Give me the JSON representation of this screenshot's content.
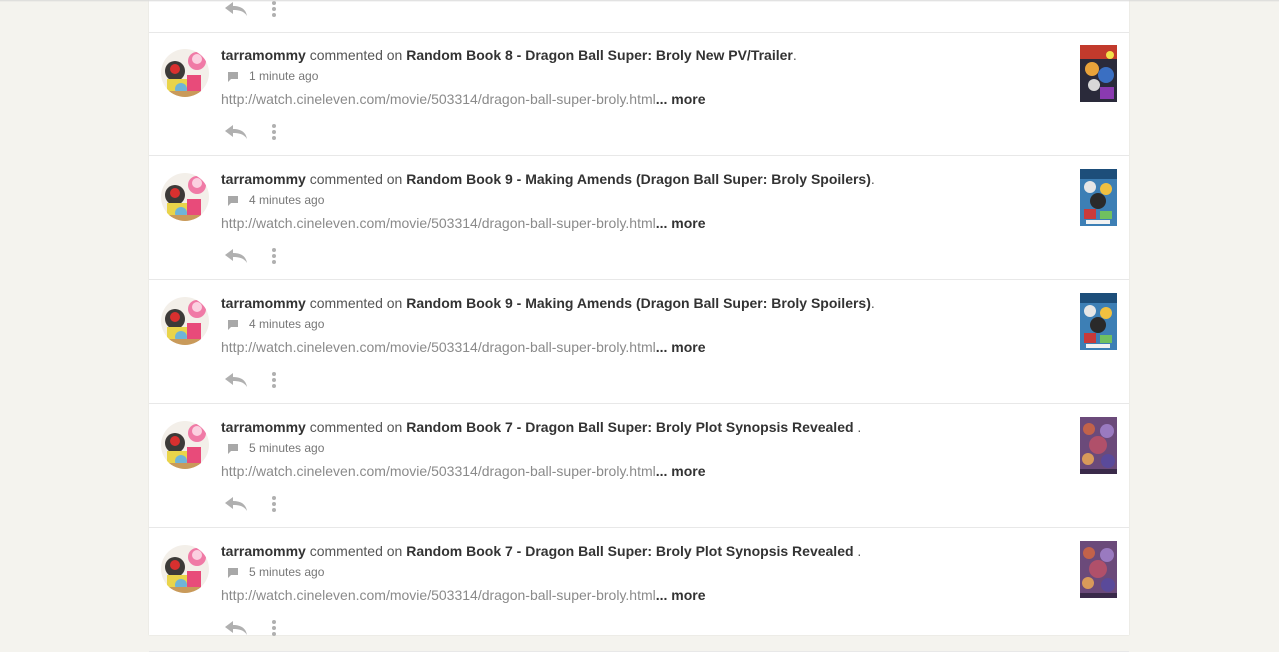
{
  "feed": {
    "items": [
      {
        "user": "tarramommy",
        "verb": " commented on ",
        "story": "Random Book 8 - Dragon Ball Super: Broly New PV/Trailer",
        "suffix": ".",
        "time": "1 minute ago",
        "snippet": "http://watch.cineleven.com/movie/503314/dragon-ball-super-broly.html",
        "more": "... more",
        "cover": "cover-8"
      },
      {
        "user": "tarramommy",
        "verb": " commented on ",
        "story": "Random Book 9 - Making Amends (Dragon Ball Super: Broly Spoilers)",
        "suffix": ".",
        "time": "4 minutes ago",
        "snippet": "http://watch.cineleven.com/movie/503314/dragon-ball-super-broly.html",
        "more": "... more",
        "cover": "cover-9"
      },
      {
        "user": "tarramommy",
        "verb": " commented on ",
        "story": "Random Book 9 - Making Amends (Dragon Ball Super: Broly Spoilers)",
        "suffix": ".",
        "time": "4 minutes ago",
        "snippet": "http://watch.cineleven.com/movie/503314/dragon-ball-super-broly.html",
        "more": "... more",
        "cover": "cover-9"
      },
      {
        "user": "tarramommy",
        "verb": " commented on ",
        "story": "Random Book 7 - Dragon Ball Super: Broly Plot Synopsis Revealed ",
        "suffix": ".",
        "time": "5 minutes ago",
        "snippet": "http://watch.cineleven.com/movie/503314/dragon-ball-super-broly.html",
        "more": "... more",
        "cover": "cover-7"
      },
      {
        "user": "tarramommy",
        "verb": " commented on ",
        "story": "Random Book 7 - Dragon Ball Super: Broly Plot Synopsis Revealed ",
        "suffix": ".",
        "time": "5 minutes ago",
        "snippet": "http://watch.cineleven.com/movie/503314/dragon-ball-super-broly.html",
        "more": "... more",
        "cover": "cover-7"
      }
    ]
  },
  "icons": {
    "comment": "comment-icon",
    "reply": "reply-icon",
    "menu": "more-vertical-icon"
  },
  "colors": {
    "page_bg": "#f4f3ee",
    "card_bg": "#ffffff",
    "text_dark": "#333333",
    "text_muted": "#8a8a8a",
    "icon_gray": "#b0b0b0"
  }
}
